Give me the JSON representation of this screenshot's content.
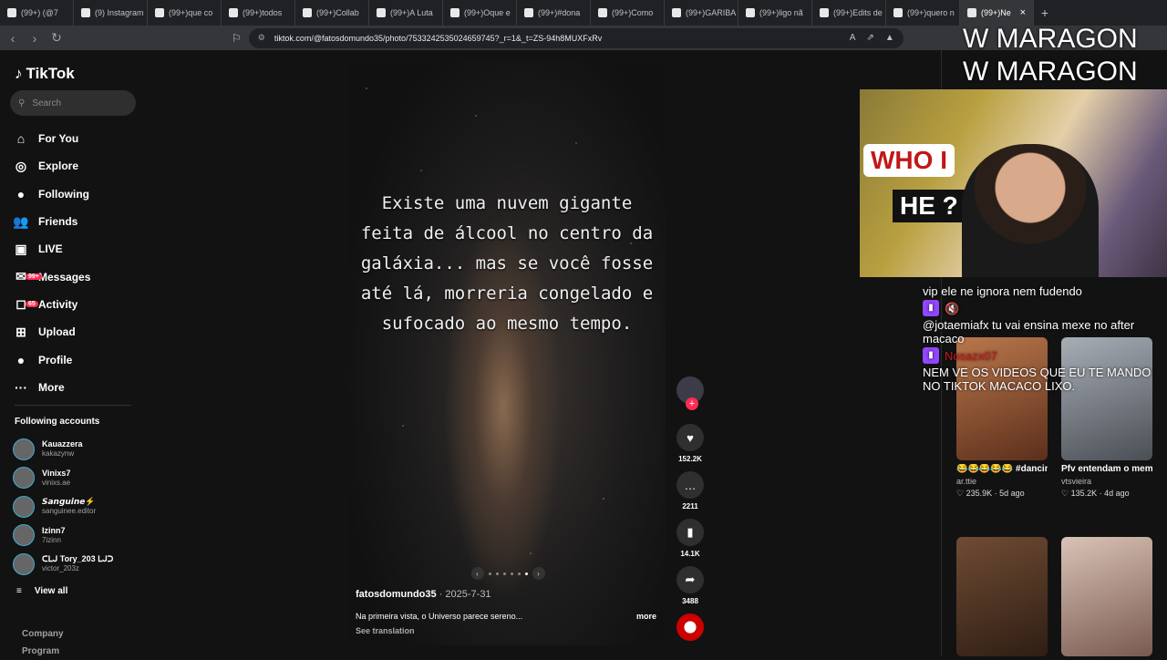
{
  "browser": {
    "tabs": [
      "(99+) (@7",
      "(9) Instagram",
      "(99+)que co",
      "(99+)todos",
      "(99+)Collab",
      "(99+)A Luta",
      "(99+)Oque e",
      "(99+)#dona",
      "(99+)Como",
      "(99+)GARIBA",
      "(99+)ligo nã",
      "(99+)Edits de",
      "(99+)quero n",
      "(99+)Ne"
    ],
    "url": "tiktok.com/@fatosdomundo35/photo/7533242535024659745?_r=1&_t=ZS-94h8MUXFxRv"
  },
  "sidebar": {
    "logo": "TikTok",
    "search_placeholder": "Search",
    "menu": [
      {
        "label": "For You",
        "icon": "home-icon",
        "glyph": "⌂"
      },
      {
        "label": "Explore",
        "icon": "compass-icon",
        "glyph": "◎"
      },
      {
        "label": "Following",
        "icon": "following-icon",
        "glyph": "●"
      },
      {
        "label": "Friends",
        "icon": "friends-icon",
        "glyph": "👥"
      },
      {
        "label": "LIVE",
        "icon": "live-icon",
        "glyph": "▣"
      },
      {
        "label": "Messages",
        "icon": "messages-icon",
        "glyph": "✉",
        "badge": "99+"
      },
      {
        "label": "Activity",
        "icon": "activity-icon",
        "glyph": "◻",
        "badge": "65"
      },
      {
        "label": "Upload",
        "icon": "upload-icon",
        "glyph": "⊞"
      },
      {
        "label": "Profile",
        "icon": "profile-icon",
        "glyph": "●"
      },
      {
        "label": "More",
        "icon": "more-icon",
        "glyph": "···"
      }
    ],
    "following_title": "Following accounts",
    "following": [
      {
        "name": "Kauazzera",
        "user": "kakazynw"
      },
      {
        "name": "Vinixs7",
        "user": "vinixs.ae"
      },
      {
        "name": "𝙎𝙖𝙣𝙜𝙪𝙞𝙣𝙚⚡",
        "user": "sanguinee.editor"
      },
      {
        "name": "Izinn7",
        "user": "7izinn"
      },
      {
        "name": "ᑕᒪᒍ Tory_203 ᒪᒍᑐ",
        "user": "victor_203z"
      }
    ],
    "view_all": "View all",
    "footer": [
      "Company",
      "Program"
    ]
  },
  "post": {
    "caption": "Existe uma nuvem gigante feita de álcool no centro da galáxia... mas se você fosse até lá, morreria congelado e sufocado ao mesmo tempo.",
    "author": "fatosdomundo35",
    "date": " · 2025-7-31",
    "description": "Na primeira vista, o Universo parece sereno...",
    "more": "more",
    "see_translation": "See translation",
    "likes": "152.2K",
    "comments": "2211",
    "saves": "14.1K",
    "shares": "3488"
  },
  "related": [
    {
      "title": "😂😂😂😂😂 #dancinha #tren...",
      "author": "ar.ttie",
      "likes": "♡ 235.9K",
      "age": "5d ago"
    },
    {
      "title": "Pfv entendam o meme #viral...",
      "author": "vtsvieira",
      "likes": "♡ 135.2K",
      "age": "4d ago"
    }
  ],
  "overlay": {
    "watermark": "W MARAGON",
    "who": "WHO I",
    "he": "HE ?",
    "chat": [
      "vip ele ne ignora nem fudendo",
      "@jotaemiafx tu vai ensina mexe no after macaco",
      "NEM VE OS VIDEOS QUE EU TE MANDO NO TIKTOK MACACO LIXO."
    ],
    "chat_user": "Nosazx07"
  }
}
